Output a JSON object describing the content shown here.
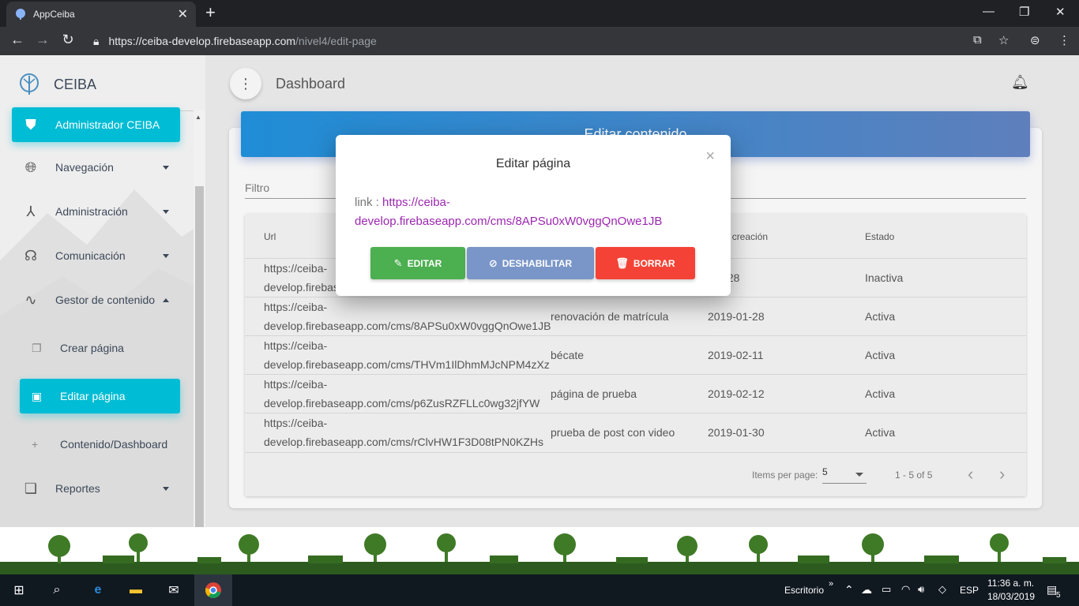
{
  "browser": {
    "tab_title": "AppCeiba",
    "url_host": "https://ceiba-develop.firebaseapp.com",
    "url_path": "/nivel4/edit-page"
  },
  "sidebar": {
    "brand": "CEIBA",
    "items": [
      {
        "label": "Administrador CEIBA",
        "icon": "shield-icon",
        "active": true
      },
      {
        "label": "Navegación",
        "icon": "globe-icon"
      },
      {
        "label": "Administración",
        "icon": "hub-icon"
      },
      {
        "label": "Comunicación",
        "icon": "speaker-icon"
      },
      {
        "label": "Gestor de contenido",
        "icon": "gesture-icon"
      },
      {
        "label": "Reportes",
        "icon": "documents-icon"
      }
    ],
    "subitems": [
      {
        "label": "Crear página",
        "icon": "file-copy-icon"
      },
      {
        "label": "Editar página",
        "icon": "edit-file-icon",
        "active": true
      },
      {
        "label": "Contenido/Dashboard",
        "icon": "plus-icon"
      }
    ]
  },
  "header": {
    "title": "Dashboard"
  },
  "card": {
    "title": "Editar contenido",
    "filter_placeholder": "Filtro"
  },
  "table": {
    "headers": {
      "url": "Url",
      "date": "a de creación",
      "state": "Estado"
    },
    "rows": [
      {
        "url1": "https://ceiba-",
        "url2": "develop.firebas",
        "name": "",
        "date": "-01-28",
        "state": "Inactiva"
      },
      {
        "url1": "https://ceiba-",
        "url2": "develop.firebaseapp.com/cms/8APSu0xW0vggQnOwe1JB",
        "name": "renovación de matrícula",
        "date": "2019-01-28",
        "state": "Activa"
      },
      {
        "url1": "https://ceiba-",
        "url2": "develop.firebaseapp.com/cms/THVm1IlDhmMJcNPM4zXz",
        "name": "bécate",
        "date": "2019-02-11",
        "state": "Activa"
      },
      {
        "url1": "https://ceiba-",
        "url2": "develop.firebaseapp.com/cms/p6ZusRZFLLc0wg32jfYW",
        "name": "página de prueba",
        "date": "2019-02-12",
        "state": "Activa"
      },
      {
        "url1": "https://ceiba-",
        "url2": "develop.firebaseapp.com/cms/rClvHW1F3D08tPN0KZHs",
        "name": "prueba de post con video",
        "date": "2019-01-30",
        "state": "Activa"
      }
    ]
  },
  "paginator": {
    "items_label": "Items per page:",
    "page_size": "5",
    "range": "1 - 5 of 5"
  },
  "modal": {
    "title": "Editar página",
    "close": "×",
    "link_label": "link : ",
    "link_url": "https://ceiba-develop.firebaseapp.com/cms/8APSu0xW0vggQnOwe1JB",
    "btn_edit": "EDITAR",
    "btn_disable": "DESHABILITAR",
    "btn_delete": "BORRAR"
  },
  "taskbar": {
    "desktop_label": "Escritorio",
    "lang": "ESP",
    "time": "11:36 a. m.",
    "date": "18/03/2019",
    "notif_count": "5"
  },
  "colors": {
    "accent": "#00bcd4",
    "edit": "#4caf50",
    "disable": "#7a96c8",
    "delete": "#f44336",
    "link": "#9c27b0"
  }
}
